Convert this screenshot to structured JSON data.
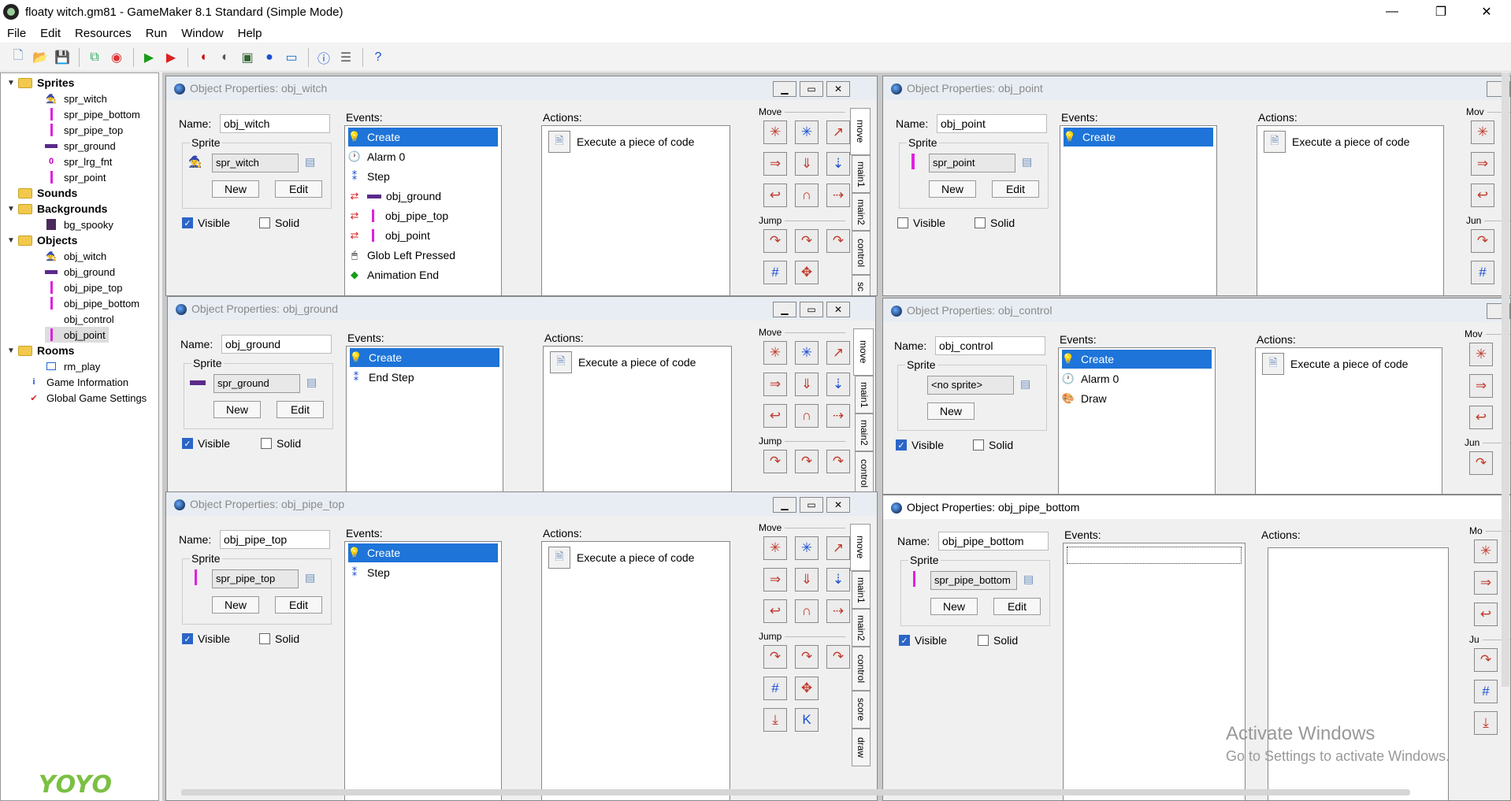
{
  "window": {
    "title": "floaty witch.gm81 - GameMaker 8.1 Standard (Simple Mode)",
    "controls": [
      "—",
      "❐",
      "✕"
    ]
  },
  "menu": [
    "File",
    "Edit",
    "Resources",
    "Run",
    "Window",
    "Help"
  ],
  "toolbar": [
    "new-file-icon",
    "open-folder-icon",
    "save-icon",
    "export-icon",
    "publish-icon",
    "run-icon",
    "debug-run-icon",
    "create-sprite-icon",
    "create-sound-icon",
    "create-background-icon",
    "create-object-icon",
    "create-room-icon",
    "game-info-icon",
    "game-settings-icon",
    "help-icon"
  ],
  "tree": {
    "sprites_label": "Sprites",
    "sprites": [
      "spr_witch",
      "spr_pipe_bottom",
      "spr_pipe_top",
      "spr_ground",
      "spr_lrg_fnt",
      "spr_point"
    ],
    "sounds_label": "Sounds",
    "backgrounds_label": "Backgrounds",
    "backgrounds": [
      "bg_spooky"
    ],
    "objects_label": "Objects",
    "objects": [
      "obj_witch",
      "obj_ground",
      "obj_pipe_top",
      "obj_pipe_bottom",
      "obj_control",
      "obj_point"
    ],
    "rooms_label": "Rooms",
    "rooms": [
      "rm_play"
    ],
    "game_information": "Game Information",
    "global_settings": "Global Game Settings"
  },
  "labels": {
    "name": "Name:",
    "sprite": "Sprite",
    "new": "New",
    "edit": "Edit",
    "visible": "Visible",
    "solid": "Solid",
    "events": "Events:",
    "actions": "Actions:",
    "move": "Move",
    "jump": "Jump",
    "tab_move": "move",
    "tab_main1": "main1",
    "tab_main2": "main2",
    "tab_control": "control",
    "tab_score": "score",
    "tab_draw": "draw",
    "tab_sc": "sc",
    "cut_move": "Mov",
    "cut_jump": "Jun",
    "cut_move2": "Mo",
    "cut_jump2": "Ju"
  },
  "windows": {
    "obj_witch": {
      "title": "Object Properties: obj_witch",
      "name": "obj_witch",
      "sprite": "spr_witch",
      "events": [
        "Create",
        "Alarm 0",
        "Step",
        "obj_ground",
        "obj_pipe_top",
        "obj_point",
        "Glob Left Pressed",
        "Animation End"
      ],
      "action": "Execute a piece of code"
    },
    "obj_point": {
      "title": "Object Properties: obj_point",
      "name": "obj_point",
      "sprite": "spr_point",
      "events": [
        "Create"
      ],
      "action": "Execute a piece of code"
    },
    "obj_ground": {
      "title": "Object Properties: obj_ground",
      "name": "obj_ground",
      "sprite": "spr_ground",
      "events": [
        "Create",
        "End Step"
      ],
      "action": "Execute a piece of code"
    },
    "obj_control": {
      "title": "Object Properties: obj_control",
      "name": "obj_control",
      "sprite": "<no sprite>",
      "events": [
        "Create",
        "Alarm 0",
        "Draw"
      ],
      "action": "Execute a piece of code"
    },
    "obj_pipe_top": {
      "title": "Object Properties: obj_pipe_top",
      "name": "obj_pipe_top",
      "sprite": "spr_pipe_top",
      "events": [
        "Create",
        "Step"
      ],
      "action": "Execute a piece of code"
    },
    "obj_pipe_bottom": {
      "title": "Object Properties: obj_pipe_bottom",
      "name": "obj_pipe_bottom",
      "sprite": "spr_pipe_bottom",
      "events": [],
      "action": ""
    }
  },
  "logo": "YOYO",
  "watermark": {
    "line1": "Activate Windows",
    "line2": "Go to Settings to activate Windows."
  },
  "colors": {
    "selection": "#1e74d8",
    "pipe_pink": "#e020e0",
    "ground_purple": "#5a2a8a"
  }
}
